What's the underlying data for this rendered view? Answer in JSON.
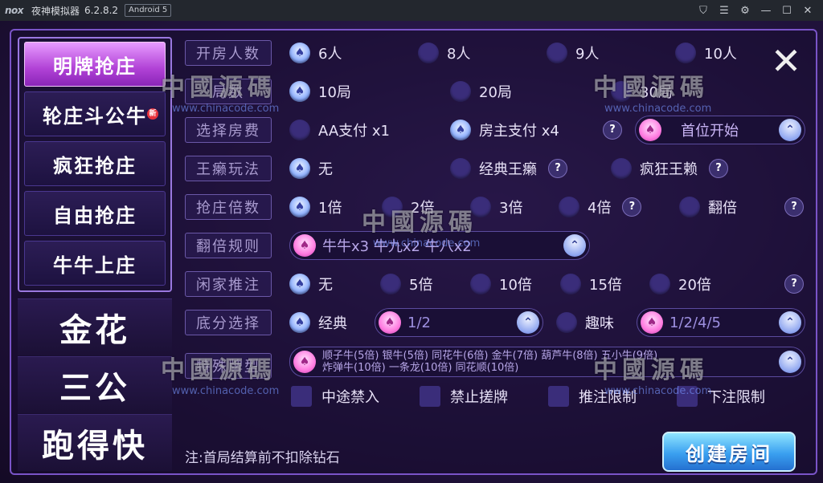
{
  "titlebar": {
    "logo": "nox",
    "app_name": "夜神模拟器",
    "version": "6.2.8.2",
    "android_badge": "Android 5",
    "icons": [
      "shirt-icon",
      "menu-icon",
      "gear-icon",
      "minimize-icon",
      "maximize-icon",
      "close-icon"
    ]
  },
  "nav": {
    "sub_items": [
      {
        "label": "明牌抢庄",
        "active": true
      },
      {
        "label": "轮庄斗公牛",
        "badge": "新"
      },
      {
        "label": "疯狂抢庄"
      },
      {
        "label": "自由抢庄"
      },
      {
        "label": "牛牛上庄"
      }
    ],
    "games": [
      "金花",
      "三公",
      "跑得快"
    ]
  },
  "rows": {
    "players": {
      "label": "开房人数",
      "options": [
        "6人",
        "8人",
        "9人",
        "10人"
      ],
      "selected": "6人"
    },
    "rounds": {
      "label": "局数",
      "options": [
        "10局",
        "20局",
        "30局"
      ],
      "selected": "10局"
    },
    "fee": {
      "label": "选择房费",
      "options": [
        "AA支付 x1",
        "房主支付 x4"
      ],
      "selected": "房主支付 x4",
      "start_select": "首位开始"
    },
    "wildcard": {
      "label": "王癞玩法",
      "options": [
        "无",
        "经典王癞",
        "疯狂王赖"
      ],
      "selected": "无"
    },
    "bank_multiplier": {
      "label": "抢庄倍数",
      "options": [
        "1倍",
        "2倍",
        "3倍",
        "4倍",
        "翻倍"
      ],
      "selected": "1倍"
    },
    "double_rule": {
      "label": "翻倍规则",
      "value": "牛牛x3 牛九x2 牛八x2"
    },
    "player_push": {
      "label": "闲家推注",
      "options": [
        "无",
        "5倍",
        "10倍",
        "15倍",
        "20倍"
      ],
      "selected": "无"
    },
    "base_score": {
      "label": "底分选择",
      "classic": "经典",
      "classic_value": "1/2",
      "fun": "趣味",
      "fun_value": "1/2/4/5",
      "selected": "经典"
    },
    "special": {
      "label": "特殊牌型",
      "line1": "顺子牛(5倍)  银牛(5倍)  同花牛(6倍)  金牛(7倍)  葫芦牛(8倍)  五小牛(9倍)",
      "line2": "炸弹牛(10倍)  一条龙(10倍)  同花顺(10倍)"
    },
    "advanced": {
      "options": [
        "中途禁入",
        "禁止搓牌",
        "推注限制",
        "下注限制"
      ]
    }
  },
  "note": "注:首局结算前不扣除钻石",
  "create_button": "创建房间",
  "watermark": {
    "text": "中國源碼",
    "url": "www.chinacode.com"
  },
  "colors": {
    "active_tab": "#c15ae3",
    "accent_blue": "#3aa0f0",
    "background": "#231440"
  }
}
